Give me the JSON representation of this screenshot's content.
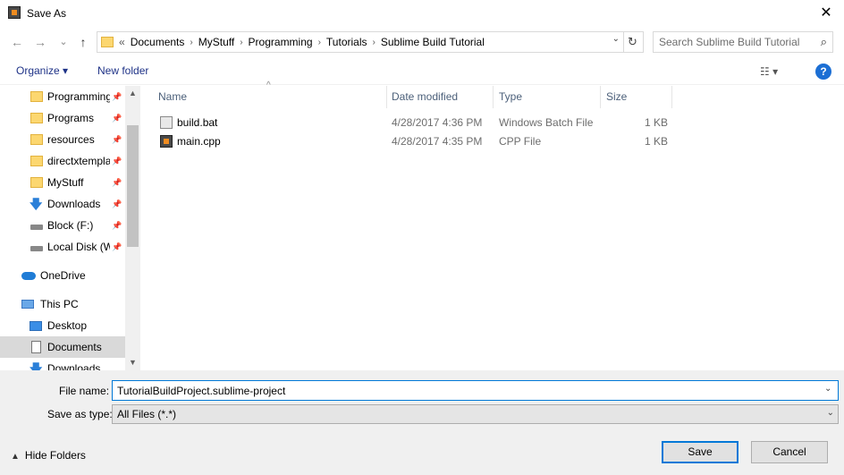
{
  "window": {
    "title": "Save As",
    "close_glyph": "✕"
  },
  "nav": {
    "back_glyph": "←",
    "forward_glyph": "→",
    "recent_glyph": "⌄",
    "up_glyph": "↑",
    "address": {
      "overflow": "«",
      "segments": [
        "Documents",
        "MyStuff",
        "Programming",
        "Tutorials",
        "Sublime Build Tutorial"
      ],
      "separator": "›",
      "dropdown_glyph": "⌄",
      "refresh_glyph": "↻"
    },
    "search_placeholder": "Search Sublime Build Tutorial",
    "search_glyph": "⌕"
  },
  "toolbar": {
    "organize_label": "Organize ▾",
    "new_folder_label": "New folder",
    "view_glyph": "☷ ▾",
    "help_glyph": "?"
  },
  "sidebar": {
    "items": [
      {
        "label": "Programming",
        "icon": "folder-icon",
        "pinned": true
      },
      {
        "label": "Programs",
        "icon": "folder-icon",
        "pinned": true
      },
      {
        "label": "resources",
        "icon": "folder-icon",
        "pinned": true
      },
      {
        "label": "directxtempla",
        "icon": "folder-icon",
        "pinned": true
      },
      {
        "label": "MyStuff",
        "icon": "folder-icon",
        "pinned": true
      },
      {
        "label": "Downloads",
        "icon": "download-icon",
        "pinned": true
      },
      {
        "label": "Block (F:)",
        "icon": "drive-icon",
        "pinned": true
      },
      {
        "label": "Local Disk (W",
        "icon": "drive-icon",
        "pinned": true
      },
      {
        "label": "OneDrive",
        "icon": "cloud-icon",
        "pinned": false
      },
      {
        "label": "This PC",
        "icon": "computer-icon",
        "pinned": false
      },
      {
        "label": "Desktop",
        "icon": "desktop-icon",
        "pinned": false
      },
      {
        "label": "Documents",
        "icon": "document-icon",
        "pinned": false,
        "selected": true
      },
      {
        "label": "Downloads",
        "icon": "download-icon",
        "pinned": false
      }
    ],
    "pin_glyph": "📌",
    "scroll_up_glyph": "▲",
    "scroll_down_glyph": "▼"
  },
  "files": {
    "columns": [
      "Name",
      "Date modified",
      "Type",
      "Size"
    ],
    "sort_glyph": "^",
    "rows": [
      {
        "name": "build.bat",
        "date": "4/28/2017 4:36 PM",
        "type": "Windows Batch File",
        "size": "1 KB",
        "icon": "batch-file-icon"
      },
      {
        "name": "main.cpp",
        "date": "4/28/2017 4:35 PM",
        "type": "CPP File",
        "size": "1 KB",
        "icon": "cpp-file-icon"
      }
    ]
  },
  "form": {
    "file_name_label": "File name:",
    "file_name_value": "TutorialBuildProject.sublime-project",
    "save_type_label": "Save as type:",
    "save_type_value": "All Files (*.*)",
    "dropdown_glyph": "⌄"
  },
  "footer": {
    "hide_folders_chevron": "▲",
    "hide_folders_label": "Hide Folders",
    "save_label": "Save",
    "cancel_label": "Cancel"
  },
  "colors": {
    "accent": "#0078d7",
    "link": "#1e3287",
    "selected_bg": "#d9d9d9",
    "panel_bg": "#f0f0f0"
  }
}
